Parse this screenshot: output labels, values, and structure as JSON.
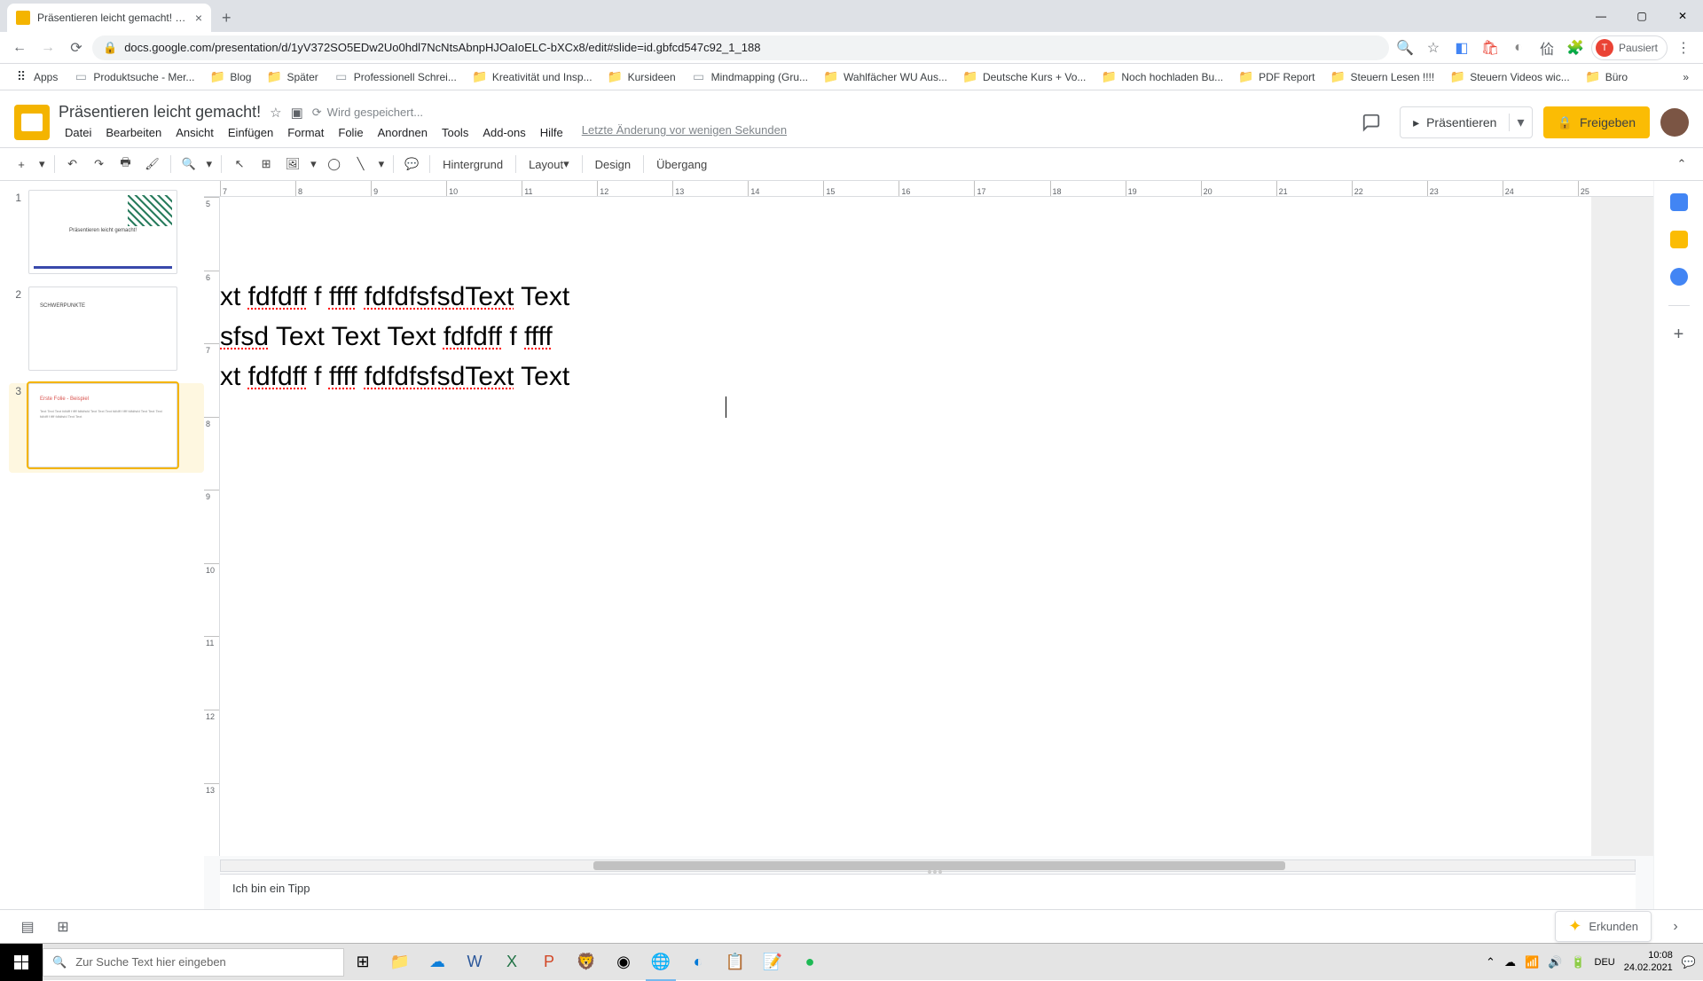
{
  "browser": {
    "tab_title": "Präsentieren leicht gemacht! - G",
    "url": "docs.google.com/presentation/d/1yV372SO5EDw2Uo0hdl7NcNtsAbnpHJOaIoELC-bXCx8/edit#slide=id.gbfcd547c92_1_188",
    "profile_label": "Pausiert",
    "bookmarks": [
      "Apps",
      "Produktsuche - Mer...",
      "Blog",
      "Später",
      "Professionell Schrei...",
      "Kreativität und Insp...",
      "Kursideen",
      "Mindmapping  (Gru...",
      "Wahlfächer WU Aus...",
      "Deutsche Kurs + Vo...",
      "Noch hochladen Bu...",
      "PDF Report",
      "Steuern Lesen !!!!",
      "Steuern Videos wic...",
      "Büro"
    ]
  },
  "slides": {
    "doc_title": "Präsentieren leicht gemacht!",
    "save_status": "Wird gespeichert...",
    "last_edit": "Letzte Änderung vor wenigen Sekunden",
    "menu": [
      "Datei",
      "Bearbeiten",
      "Ansicht",
      "Einfügen",
      "Format",
      "Folie",
      "Anordnen",
      "Tools",
      "Add-ons",
      "Hilfe"
    ],
    "present": "Präsentieren",
    "share": "Freigeben",
    "toolbar": {
      "hintergrund": "Hintergrund",
      "layout": "Layout",
      "design": "Design",
      "uebergang": "Übergang"
    },
    "thumbs": {
      "t1": "Präsentieren leicht gemacht!",
      "t2": "SCHWERPUNKTE",
      "t3_title": "Erste Folie - Beispiel",
      "t3_body": "Text Text Text fdfdff f ffff fdfdfsfd Text Text Text fdfdff f ffff fdfdfsfd Text Text Text fdfdff f ffff fdfdfsfd Text Text"
    },
    "canvas_text": {
      "l1a": "xt ",
      "l1b": "fdfdff",
      "l1c": " f ",
      "l1d": "ffff",
      "l1e": " ",
      "l1f": "fdfdfsfsdText",
      "l1g": " Text",
      "l2a": "sfsd",
      "l2b": " Text Text Text ",
      "l2c": "fdfdff",
      "l2d": " f ",
      "l2e": "ffff",
      "l3a": "xt ",
      "l3b": "fdfdff",
      "l3c": " f ",
      "l3d": "ffff",
      "l3e": " ",
      "l3f": "fdfdfsfsdText",
      "l3g": " Text"
    },
    "notes": "Ich bin ein Tipp",
    "explore": "Erkunden",
    "ruler_h": [
      "7",
      "8",
      "9",
      "10",
      "11",
      "12",
      "13",
      "14",
      "15",
      "16",
      "17",
      "18",
      "19",
      "20",
      "21",
      "22",
      "23",
      "24",
      "25"
    ],
    "ruler_v": [
      "5",
      "6",
      "7",
      "8",
      "9",
      "10",
      "11",
      "12",
      "13"
    ]
  },
  "taskbar": {
    "search_placeholder": "Zur Suche Text hier eingeben",
    "lang": "DEU",
    "time": "10:08",
    "date": "24.02.2021"
  }
}
